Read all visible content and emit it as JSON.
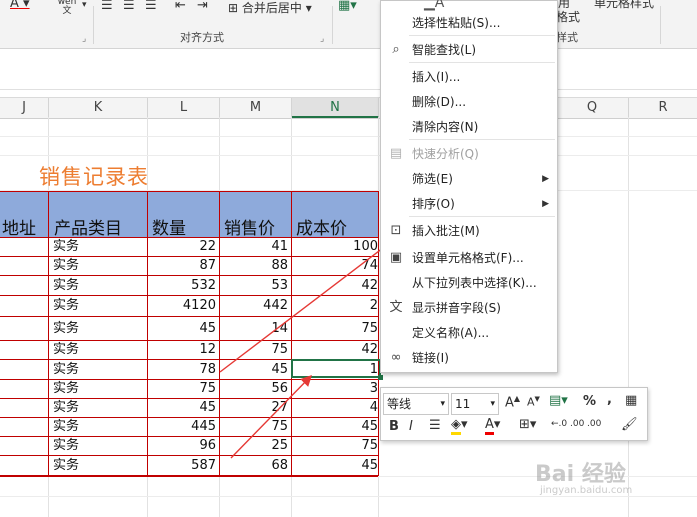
{
  "ribbon": {
    "text_color_letter": "A",
    "phonetic_label": "wén 文",
    "merge_center_label": "合并后居中",
    "alignment_group_label": "对齐方式",
    "style_group_label_fragment": "样式",
    "cell_format_fragment": "格式",
    "table_format_fragment": "单元格样式",
    "use_fragment": "用"
  },
  "columns": [
    "J",
    "K",
    "L",
    "M",
    "N",
    "O",
    "P",
    "Q",
    "R"
  ],
  "selected_column": "N",
  "sheet_title": "销售记录表",
  "table": {
    "headers": [
      "地址",
      "产品类目",
      "数量",
      "销售价",
      "成本价"
    ],
    "rows": [
      [
        "实务",
        "22",
        "41",
        "100"
      ],
      [
        "实务",
        "87",
        "88",
        "74"
      ],
      [
        "实务",
        "532",
        "53",
        "42"
      ],
      [
        "实务",
        "4120",
        "442",
        "2"
      ],
      [
        "实务",
        "45",
        "14",
        "75"
      ],
      [
        "实务",
        "12",
        "75",
        "42"
      ],
      [
        "实务",
        "78",
        "45",
        "1"
      ],
      [
        "实务",
        "75",
        "56",
        "3"
      ],
      [
        "实务",
        "45",
        "27",
        "4"
      ],
      [
        "实务",
        "445",
        "75",
        "45"
      ],
      [
        "实务",
        "96",
        "25",
        "75"
      ],
      [
        "实务",
        "587",
        "68",
        "45"
      ]
    ]
  },
  "context_menu": {
    "items": [
      {
        "label": "选择性粘贴(S)...",
        "icon": "paste-special-icon",
        "disabled": false,
        "submenu": false
      },
      {
        "label": "智能查找(L)",
        "icon": "smart-lookup-icon",
        "disabled": false,
        "submenu": false
      },
      {
        "label": "插入(I)...",
        "icon": "",
        "disabled": false,
        "submenu": false
      },
      {
        "label": "删除(D)...",
        "icon": "",
        "disabled": false,
        "submenu": false
      },
      {
        "label": "清除内容(N)",
        "icon": "",
        "disabled": false,
        "submenu": false
      },
      {
        "label": "快速分析(Q)",
        "icon": "quick-analysis-icon",
        "disabled": true,
        "submenu": false
      },
      {
        "label": "筛选(E)",
        "icon": "",
        "disabled": false,
        "submenu": true
      },
      {
        "label": "排序(O)",
        "icon": "",
        "disabled": false,
        "submenu": true
      },
      {
        "label": "插入批注(M)",
        "icon": "insert-comment-icon",
        "disabled": false,
        "submenu": false
      },
      {
        "label": "设置单元格格式(F)...",
        "icon": "format-cells-icon",
        "disabled": false,
        "submenu": false
      },
      {
        "label": "从下拉列表中选择(K)...",
        "icon": "",
        "disabled": false,
        "submenu": false
      },
      {
        "label": "显示拼音字段(S)",
        "icon": "phonetic-icon",
        "disabled": false,
        "submenu": false
      },
      {
        "label": "定义名称(A)...",
        "icon": "",
        "disabled": false,
        "submenu": false
      },
      {
        "label": "链接(I)",
        "icon": "link-icon",
        "disabled": false,
        "submenu": false
      }
    ]
  },
  "mini_toolbar": {
    "font_name": "等线",
    "font_size": "11",
    "bold": "B",
    "italic": "I",
    "percent": "%",
    "comma": ",",
    "grow_font": "A",
    "shrink_font": "A",
    "increase_decimal": "←.0 .00",
    "decrease_decimal": ".00 →.0"
  },
  "watermark": {
    "text": "Bai 经验",
    "sub": "jingyan.baidu.com"
  },
  "colors": {
    "accent_green": "#217346",
    "header_fill": "#8eaadb",
    "border_red": "#c00000",
    "title_orange": "#ed7d31",
    "arrow_red": "#e53935"
  }
}
